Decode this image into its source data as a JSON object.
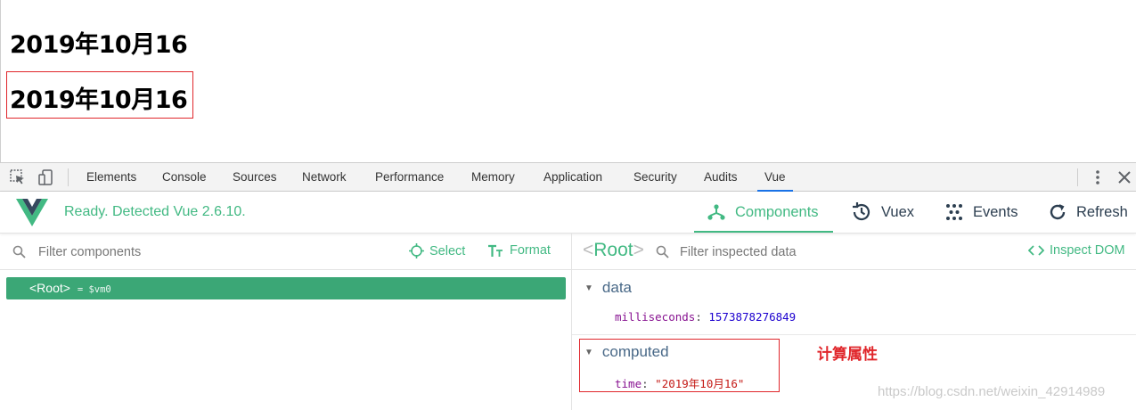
{
  "page": {
    "heading_1": "2019年10月16",
    "heading_2": "2019年10月16"
  },
  "devtools": {
    "tabs": [
      {
        "label": "Elements"
      },
      {
        "label": "Console"
      },
      {
        "label": "Sources"
      },
      {
        "label": "Network"
      },
      {
        "label": "Performance"
      },
      {
        "label": "Memory"
      },
      {
        "label": "Application"
      },
      {
        "label": "Security"
      },
      {
        "label": "Audits"
      },
      {
        "label": "Vue",
        "active": true
      }
    ]
  },
  "vue_devtools": {
    "status": "Ready. Detected Vue 2.6.10.",
    "nav": {
      "components": "Components",
      "vuex": "Vuex",
      "events": "Events",
      "refresh": "Refresh"
    },
    "left": {
      "filter_placeholder": "Filter components",
      "select_label": "Select",
      "format_label": "Format",
      "root_component": "<Root>",
      "vm_ref": "= $vm0"
    },
    "right": {
      "root_open": "<",
      "root_name": "Root",
      "root_close": ">",
      "filter_placeholder": "Filter inspected data",
      "inspect_dom_label": "Inspect DOM",
      "data_section": "data",
      "data_key": "milliseconds",
      "data_value": "1573878276849",
      "computed_section": "computed",
      "computed_key": "time",
      "computed_value": "\"2019年10月16\""
    }
  },
  "annotation": "计算属性",
  "watermark": "https://blog.csdn.net/weixin_42914989",
  "colors": {
    "vue_green": "#42b983",
    "selected_row": "#3ba776",
    "annotation_red": "#e0262b",
    "active_tab_underline": "#1a73e8"
  }
}
